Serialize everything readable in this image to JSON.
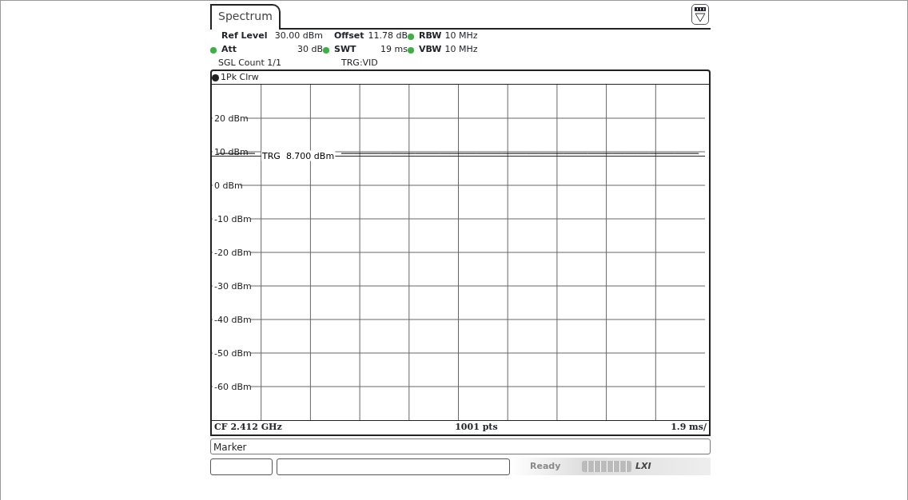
{
  "tab": {
    "label": "Spectrum",
    "selected": true
  },
  "settings": [
    [
      {
        "label": "Ref Level",
        "value": "30.00 dBm",
        "indicator": false
      },
      {
        "label": "Offset",
        "value": "11.78 dB",
        "indicator": false
      },
      {
        "label": "RBW",
        "value": "10 MHz",
        "indicator": true
      }
    ],
    [
      {
        "label": "Att",
        "value": "30 dB",
        "indicator": true
      },
      {
        "label": "SWT",
        "value": "19 ms",
        "indicator": true
      },
      {
        "label": "VBW",
        "value": "10 MHz",
        "indicator": true
      }
    ]
  ],
  "status_line": [
    "SGL Count 1/1",
    "TRG:VID"
  ],
  "chart_data": {
    "type": "line",
    "categories": [
      null,
      null,
      null,
      null,
      null,
      null,
      null,
      null,
      null,
      null,
      null,
      null,
      null,
      null,
      null,
      null,
      null,
      null,
      null,
      null,
      null,
      null,
      null,
      null,
      null,
      null,
      null,
      null,
      null,
      null,
      null,
      null,
      null,
      null,
      null,
      null,
      null,
      null,
      null,
      null
    ],
    "series": [
      {
        "name": "1Pk Clrw",
        "color": "#000000",
        "values": [
          9.5,
          9.5,
          9.5,
          9.5,
          null,
          null,
          null,
          null,
          null,
          null,
          9.5,
          9.5,
          9.5,
          9.5,
          9.5,
          9.5,
          9.5,
          9.5,
          9.5,
          9.5,
          9.5,
          9.5,
          9.5,
          9.5,
          9.5,
          9.5,
          9.5,
          9.5,
          9.5,
          9.5,
          9.5,
          9.5,
          9.5,
          9.5,
          9.5,
          9.5,
          9.5,
          9.5,
          9.5,
          9.5
        ]
      }
    ],
    "ylim": [
      -70,
      30
    ],
    "yticks": [
      {
        "value": 20,
        "label": "20 dBm"
      },
      {
        "value": 10,
        "label": "10 dBm"
      },
      {
        "value": 0,
        "label": "0 dBm"
      },
      {
        "value": -10,
        "label": "-10 dBm"
      },
      {
        "value": -20,
        "label": "-20 dBm"
      },
      {
        "value": -30,
        "label": "-30 dBm"
      },
      {
        "value": -40,
        "label": "-40 dBm"
      },
      {
        "value": -50,
        "label": "-50 dBm"
      },
      {
        "value": -60,
        "label": "-60 dBm"
      }
    ],
    "grid": true,
    "ref_lines": [
      {
        "axis": "y",
        "value": 8.7,
        "label": "TRG  8.700 dBm"
      }
    ]
  },
  "footer": {
    "left": "CF 2.412 GHz",
    "center": "1001 pts",
    "right": "1.9 ms/"
  },
  "marker_label": "Marker",
  "status_bar": {
    "state": "Ready",
    "logo": "LXI"
  }
}
